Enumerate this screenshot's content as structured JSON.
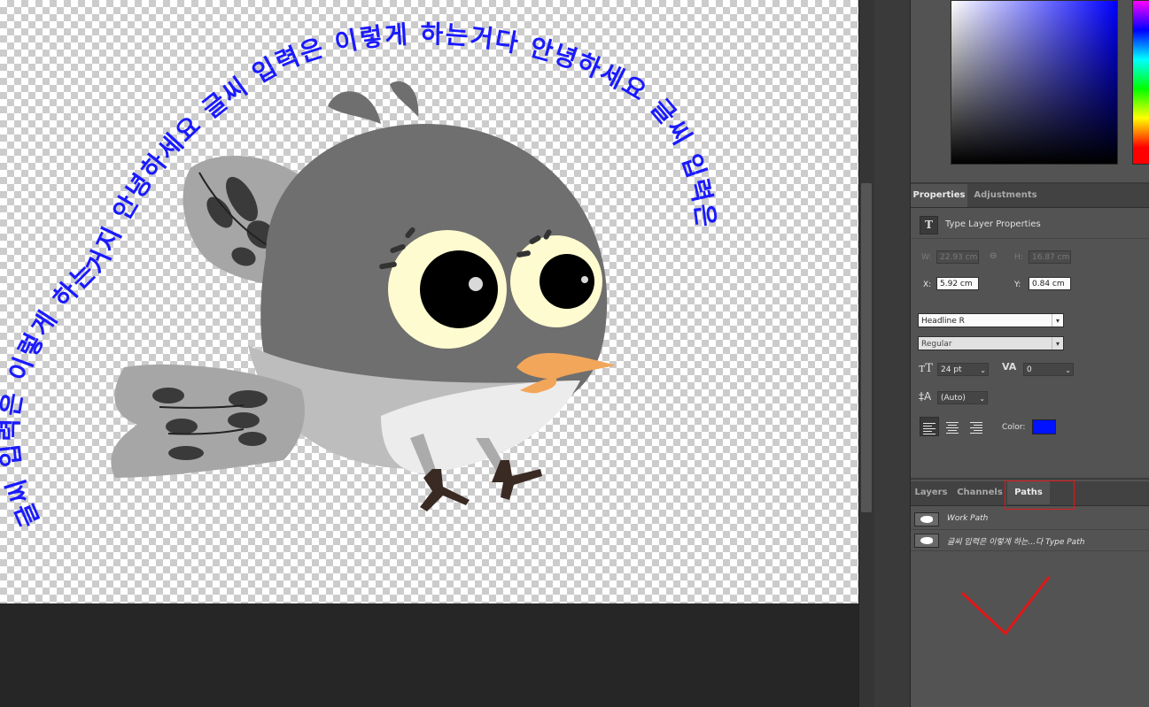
{
  "canvas": {
    "curved_text": "글씨 입력은 이렇게 하는거지 안녕하세요 글씨 입력은 이렇게 하는거다 안녕하세요 글씨 입력은",
    "text_color": "#1a1aff"
  },
  "properties_panel": {
    "tabs": [
      "Properties",
      "Adjustments"
    ],
    "active_tab": "Properties",
    "title": "Type Layer Properties",
    "icon": "type-layer-icon",
    "w_label": "W:",
    "w_value": "22.93 cm",
    "h_label": "H:",
    "h_value": "16.87 cm",
    "x_label": "X:",
    "x_value": "5.92 cm",
    "y_label": "Y:",
    "y_value": "0.84 cm",
    "font_family": "Headline R",
    "font_style": "Regular",
    "font_size": "24 pt",
    "tracking": "0",
    "leading": "(Auto)",
    "color_label": "Color:",
    "color_value": "#0012ff"
  },
  "paths_panel": {
    "tabs": [
      "Layers",
      "Channels",
      "Paths"
    ],
    "active_tab": "Paths",
    "paths": [
      {
        "name": "Work Path"
      },
      {
        "name": "글씨 입력은 이렇게 하는...다  Type Path"
      }
    ]
  },
  "annotation": {
    "color": "#e01818",
    "checkmark": "checkmark-annotation"
  }
}
